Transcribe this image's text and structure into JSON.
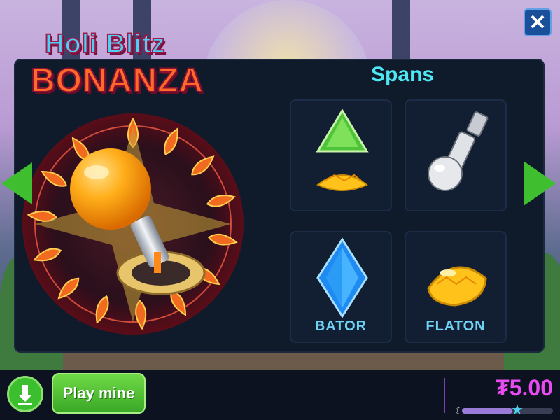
{
  "logo": {
    "line1": "Holi Blitz",
    "line2": "BONANZA"
  },
  "close": {
    "glyph": "✕"
  },
  "spans": {
    "title": "Spans",
    "items": [
      {
        "label": "",
        "icon": "green-gem-gold-nugget-icon"
      },
      {
        "label": "",
        "icon": "silver-pin-icon"
      },
      {
        "label": "BATOR",
        "icon": "blue-diamond-icon"
      },
      {
        "label": "FLATON",
        "icon": "gold-nugget-icon"
      }
    ]
  },
  "play_button": {
    "label": "Play mine"
  },
  "balance": {
    "value": "₮5.00"
  },
  "progress": {
    "fraction": 0.55
  },
  "colors": {
    "accent_green": "#3fbf2f",
    "title_cyan": "#4de6f2",
    "balance_magenta": "#e84cf0"
  }
}
